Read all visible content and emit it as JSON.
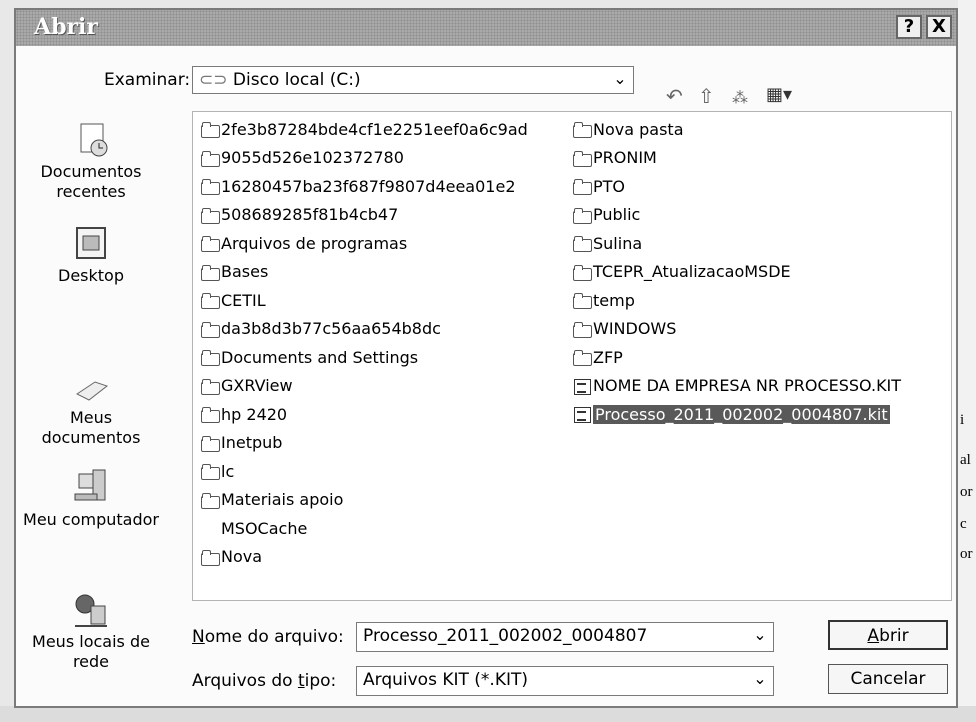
{
  "dialog": {
    "title": "Abrir",
    "help_glyph": "?",
    "close_glyph": "X"
  },
  "lookin": {
    "label": "Examinar:",
    "value": "Disco local (C:)",
    "arrow": "⌄"
  },
  "toolbar": {
    "back": "↶",
    "up": "⇧",
    "new_folder": "⁂",
    "views": "▦▾"
  },
  "places": [
    {
      "label_line1": "Documentos",
      "label_line2": "recentes",
      "icon": "recent-documents-icon"
    },
    {
      "label_line1": "Desktop",
      "label_line2": "",
      "icon": "desktop-icon"
    },
    {
      "label_line1": "Meus",
      "label_line2": "documentos",
      "icon": "my-documents-icon"
    },
    {
      "label_line1": "Meu computador",
      "label_line2": "",
      "icon": "my-computer-icon"
    },
    {
      "label_line1": "Meus locais de",
      "label_line2": "rede",
      "icon": "network-places-icon"
    }
  ],
  "files_col1": [
    {
      "name": "2fe3b87284bde4cf1e2251eef0a6c9ad",
      "type": "folder"
    },
    {
      "name": "9055d526e102372780",
      "type": "folder"
    },
    {
      "name": "16280457ba23f687f9807d4eea01e2",
      "type": "folder"
    },
    {
      "name": "508689285f81b4cb47",
      "type": "folder"
    },
    {
      "name": "Arquivos de programas",
      "type": "folder"
    },
    {
      "name": "Bases",
      "type": "folder"
    },
    {
      "name": "CETIL",
      "type": "folder"
    },
    {
      "name": "da3b8d3b77c56aa654b8dc",
      "type": "folder"
    },
    {
      "name": "Documents and Settings",
      "type": "folder"
    },
    {
      "name": "GXRView",
      "type": "folder"
    },
    {
      "name": "hp 2420",
      "type": "folder"
    },
    {
      "name": "Inetpub",
      "type": "folder"
    },
    {
      "name": "lc",
      "type": "folder"
    },
    {
      "name": "Materiais apoio",
      "type": "folder"
    },
    {
      "name": "MSOCache",
      "type": "none"
    },
    {
      "name": "Nova",
      "type": "folder"
    }
  ],
  "files_col2": [
    {
      "name": "Nova pasta",
      "type": "folder"
    },
    {
      "name": "PRONIM",
      "type": "folder"
    },
    {
      "name": "PTO",
      "type": "folder"
    },
    {
      "name": "Public",
      "type": "folder"
    },
    {
      "name": "Sulina",
      "type": "folder"
    },
    {
      "name": "TCEPR_AtualizacaoMSDE",
      "type": "folder"
    },
    {
      "name": "temp",
      "type": "folder"
    },
    {
      "name": "WINDOWS",
      "type": "folder"
    },
    {
      "name": "ZFP",
      "type": "folder"
    },
    {
      "name": "NOME DA EMPRESA NR PROCESSO.KIT",
      "type": "doc"
    },
    {
      "name": "Processo_2011_002002_0004807.kit",
      "type": "doc",
      "selected": true
    }
  ],
  "filename": {
    "label_underlined": "N",
    "label_rest": "ome do arquivo:",
    "value": "Processo_2011_002002_0004807"
  },
  "filetype": {
    "label_before": "Arquivos do ",
    "label_underlined": "t",
    "label_after": "ipo:",
    "value": "Arquivos KIT (*.KIT)"
  },
  "buttons": {
    "open_underlined": "A",
    "open_rest": "brir",
    "cancel": "Cancelar"
  },
  "background_fragments": [
    "i",
    "al",
    "or",
    "c",
    "or"
  ]
}
